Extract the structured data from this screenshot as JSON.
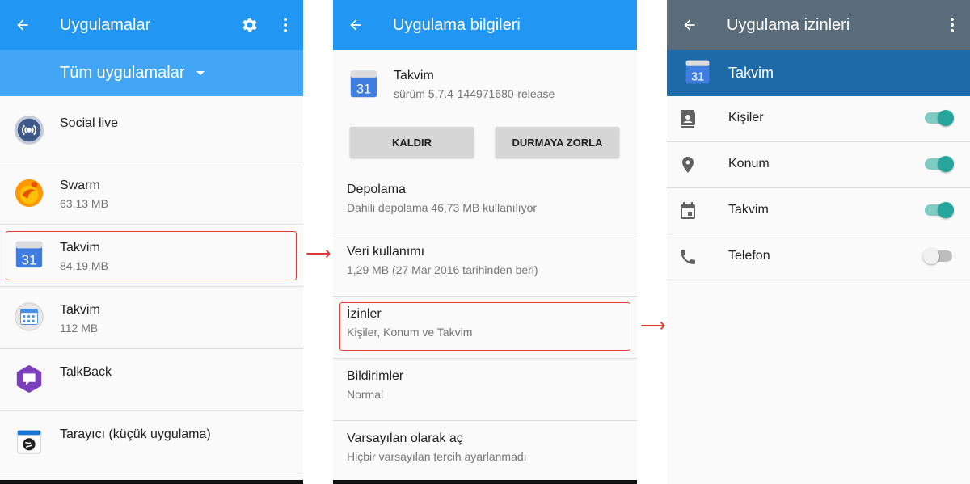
{
  "colors": {
    "appbar_blue": "#2196f3",
    "filter_blue": "#42a5f5",
    "appbar_gray": "#5a6b79",
    "banner_blue": "#1e6aa8",
    "highlight_red": "#e53935",
    "toggle_teal": "#26a69a"
  },
  "screen1": {
    "title": "Uygulamalar",
    "filter_label": "Tüm uygulamalar",
    "apps": [
      {
        "name": "Social live",
        "size": "",
        "icon": "social-live-icon"
      },
      {
        "name": "Swarm",
        "size": "63,13 MB",
        "icon": "swarm-icon"
      },
      {
        "name": "Takvim",
        "size": "84,19 MB",
        "icon": "google-calendar-icon"
      },
      {
        "name": "Takvim",
        "size": "112 MB",
        "icon": "calendar-grid-icon"
      },
      {
        "name": "TalkBack",
        "size": "",
        "icon": "talkback-icon"
      },
      {
        "name": "Tarayıcı (küçük uygulama)",
        "size": "",
        "icon": "browser-icon"
      }
    ]
  },
  "screen2": {
    "title": "Uygulama bilgileri",
    "app_name": "Takvim",
    "app_version": "sürüm 5.7.4-144971680-release",
    "uninstall_label": "KALDIR",
    "force_stop_label": "DURMAYA ZORLA",
    "rows": [
      {
        "title": "Depolama",
        "subtitle": "Dahili depolama 46,73 MB kullanılıyor"
      },
      {
        "title": "Veri kullanımı",
        "subtitle": "1,29 MB (27 Mar 2016 tarihinden beri)"
      },
      {
        "title": "İzinler",
        "subtitle": "Kişiler, Konum ve Takvim"
      },
      {
        "title": "Bildirimler",
        "subtitle": "Normal"
      },
      {
        "title": "Varsayılan olarak aç",
        "subtitle": "Hiçbir varsayılan tercih ayarlanmadı"
      }
    ]
  },
  "screen3": {
    "title": "Uygulama izinleri",
    "app_name": "Takvim",
    "calendar_icon_day": "31",
    "permissions": [
      {
        "label": "Kişiler",
        "enabled": true,
        "icon": "contacts-icon"
      },
      {
        "label": "Konum",
        "enabled": true,
        "icon": "location-icon"
      },
      {
        "label": "Takvim",
        "enabled": true,
        "icon": "calendar-icon"
      },
      {
        "label": "Telefon",
        "enabled": false,
        "icon": "phone-icon"
      }
    ]
  }
}
